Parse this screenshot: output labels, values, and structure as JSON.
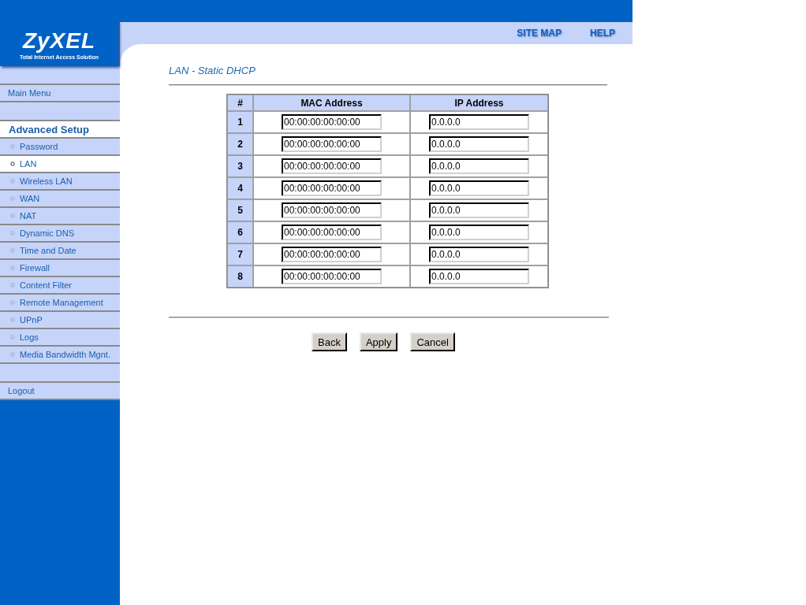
{
  "logo": {
    "name": "ZyXEL",
    "tagline": "Total Internet Access Solution"
  },
  "top_links": [
    "SITE MAP",
    "HELP"
  ],
  "sidebar": {
    "main_menu": "Main Menu",
    "section": "Advanced Setup",
    "items": [
      {
        "label": "Password",
        "selected": false
      },
      {
        "label": "LAN",
        "selected": true
      },
      {
        "label": "Wireless LAN",
        "selected": false
      },
      {
        "label": "WAN",
        "selected": false
      },
      {
        "label": "NAT",
        "selected": false
      },
      {
        "label": "Dynamic DNS",
        "selected": false
      },
      {
        "label": "Time and Date",
        "selected": false
      },
      {
        "label": "Firewall",
        "selected": false
      },
      {
        "label": "Content Filter",
        "selected": false
      },
      {
        "label": "Remote Management",
        "selected": false
      },
      {
        "label": "UPnP",
        "selected": false
      },
      {
        "label": "Logs",
        "selected": false
      },
      {
        "label": "Media Bandwidth Mgnt.",
        "selected": false
      }
    ],
    "logout": "Logout"
  },
  "page_title": "LAN - Static DHCP",
  "table": {
    "columns": [
      "#",
      "MAC Address",
      "IP Address"
    ],
    "rows": [
      {
        "index": "1",
        "mac": "00:00:00:00:00:00",
        "ip": "0.0.0.0"
      },
      {
        "index": "2",
        "mac": "00:00:00:00:00:00",
        "ip": "0.0.0.0"
      },
      {
        "index": "3",
        "mac": "00:00:00:00:00:00",
        "ip": "0.0.0.0"
      },
      {
        "index": "4",
        "mac": "00:00:00:00:00:00",
        "ip": "0.0.0.0"
      },
      {
        "index": "5",
        "mac": "00:00:00:00:00:00",
        "ip": "0.0.0.0"
      },
      {
        "index": "6",
        "mac": "00:00:00:00:00:00",
        "ip": "0.0.0.0"
      },
      {
        "index": "7",
        "mac": "00:00:00:00:00:00",
        "ip": "0.0.0.0"
      },
      {
        "index": "8",
        "mac": "00:00:00:00:00:00",
        "ip": "0.0.0.0"
      }
    ]
  },
  "buttons": [
    "Back",
    "Apply",
    "Cancel"
  ]
}
